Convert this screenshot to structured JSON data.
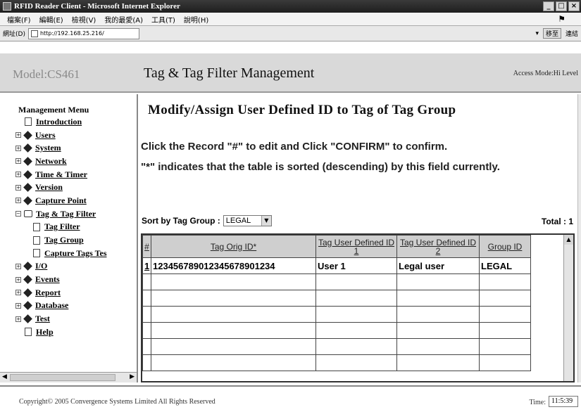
{
  "window": {
    "title": "RFID Reader Client - Microsoft Internet Explorer",
    "controls": [
      "_",
      "□",
      "×"
    ]
  },
  "menubar": {
    "items": [
      "檔案(F)",
      "編輯(E)",
      "檢視(V)",
      "我的最愛(A)",
      "工具(T)",
      "說明(H)"
    ]
  },
  "addressbar": {
    "label": "網址(D)",
    "url": "http://192.168.25.216/",
    "go_label": "移至",
    "links_label": "連結"
  },
  "header": {
    "model": "Model:CS461",
    "title": "Tag & Tag Filter Management",
    "access_mode": "Access Mode:Hi Level"
  },
  "nav": {
    "heading": "Management Menu",
    "items": [
      {
        "label": "Introduction",
        "level": 0,
        "kind": "doc",
        "exp": ""
      },
      {
        "label": "Users",
        "level": 0,
        "kind": "folder",
        "exp": "+"
      },
      {
        "label": "System",
        "level": 0,
        "kind": "folder",
        "exp": "+"
      },
      {
        "label": "Network",
        "level": 0,
        "kind": "folder",
        "exp": "+"
      },
      {
        "label": "Time & Timer",
        "level": 0,
        "kind": "folder",
        "exp": "+"
      },
      {
        "label": "Version",
        "level": 0,
        "kind": "folder",
        "exp": "+"
      },
      {
        "label": "Capture Point",
        "level": 0,
        "kind": "folder",
        "exp": "+"
      },
      {
        "label": "Tag & Tag Filter",
        "level": 0,
        "kind": "open",
        "exp": "−"
      },
      {
        "label": "Tag Filter",
        "level": 1,
        "kind": "doc",
        "exp": ""
      },
      {
        "label": "Tag Group",
        "level": 1,
        "kind": "doc",
        "exp": ""
      },
      {
        "label": "Capture Tags Tes",
        "level": 1,
        "kind": "doc",
        "exp": ""
      },
      {
        "label": "I/O",
        "level": 0,
        "kind": "folder",
        "exp": "+"
      },
      {
        "label": "Events",
        "level": 0,
        "kind": "folder",
        "exp": "+"
      },
      {
        "label": "Report",
        "level": 0,
        "kind": "folder",
        "exp": "+"
      },
      {
        "label": "Database",
        "level": 0,
        "kind": "folder",
        "exp": "+"
      },
      {
        "label": "Test",
        "level": 0,
        "kind": "folder",
        "exp": "+"
      },
      {
        "label": "Help",
        "level": 0,
        "kind": "doc",
        "exp": ""
      }
    ]
  },
  "main": {
    "heading": "Modify/Assign User Defined ID to Tag of Tag Group",
    "instruction_1": "Click the Record \"#\" to edit and Click \"CONFIRM\" to confirm.",
    "instruction_2": "\"*\" indicates that the table is sorted (descending) by this field currently.",
    "sort_label": "Sort by Tag Group :",
    "sort_value": "LEGAL",
    "total": "Total : 1",
    "columns": [
      "#",
      "Tag Orig ID*",
      "Tag User Defined ID 1",
      "Tag User Defined ID 2",
      "Group ID"
    ],
    "rows": [
      [
        "1",
        "123456789012345678901234",
        "User 1",
        "Legal user",
        "LEGAL"
      ],
      [
        "",
        "",
        "",
        "",
        ""
      ],
      [
        "",
        "",
        "",
        "",
        ""
      ],
      [
        "",
        "",
        "",
        "",
        ""
      ],
      [
        "",
        "",
        "",
        "",
        ""
      ],
      [
        "",
        "",
        "",
        "",
        ""
      ],
      [
        "",
        "",
        "",
        "",
        ""
      ]
    ]
  },
  "footer": {
    "copyright": "Copyright© 2005 Convergence Systems Limited All Rights Reserved",
    "time_label": "Time:",
    "time_value": "11:5:39"
  }
}
